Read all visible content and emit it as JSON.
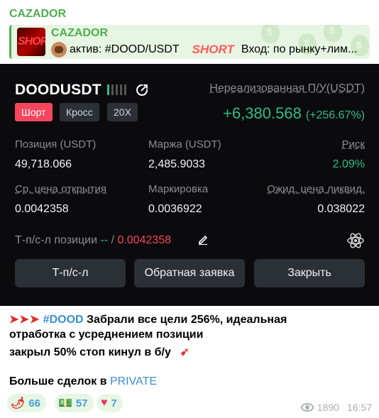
{
  "message": {
    "sender": "CAZADOR",
    "reply": {
      "thumb_text": "SHORT",
      "title": "CAZADOR",
      "text_prefix": "актив: #DOOD/USDT",
      "short_label": "SHORT",
      "text_suffix": "Вход: по рынку+лим..."
    }
  },
  "card": {
    "symbol": "DOODUSDT",
    "unrealized_label": "Нереализованная П/У(USDT)",
    "tags": {
      "side": "Шорт",
      "margin_mode": "Кросс",
      "leverage": "20X"
    },
    "pnl_value": "+6,380.568",
    "pnl_percent": "(+256.67%)",
    "position_label": "Позиция (USDT)",
    "position_value": "49,718.066",
    "margin_label": "Маржа (USDT)",
    "margin_value": "2,485.9033",
    "risk_label": "Риск",
    "risk_value": "2.09%",
    "entry_label": "Ср. цена открытия",
    "entry_value": "0.0042358",
    "mark_label": "Маркировка",
    "mark_value": "0.0036922",
    "liq_label": "Ожид. цена ликвид.",
    "liq_value": "0.038022",
    "tpsl_label": "Т-п/с-л позиции",
    "tpsl_tp": "--",
    "tpsl_sep": "/",
    "tpsl_sl": "0.0042358",
    "buttons": {
      "tpsl": "Т-п/с-л",
      "reverse": "Обратная заявка",
      "close": "Закрыть"
    },
    "colors": {
      "green": "#2ebd85",
      "red": "#f6465d",
      "bg": "#0b0b0d"
    }
  },
  "text": {
    "arrows": "➤➤➤",
    "hashtag": "#DOOD",
    "line1": "Забрали все цели 256%, идеальная",
    "line2": "отработка с усреднением позиции",
    "line3": "закрыл 50% стоп кинул в б/у",
    "line4_prefix": "Больше сделок в",
    "line4_link": "PRIVATE"
  },
  "reactions": [
    {
      "icon": "chili-pepper-icon",
      "emoji": "🌶",
      "count": "66"
    },
    {
      "icon": "money-stack-icon",
      "emoji": "💵",
      "count": "57"
    },
    {
      "icon": "heart-icon",
      "emoji": "♥",
      "count": "7"
    }
  ],
  "meta": {
    "views": "1890",
    "time": "16:57"
  }
}
